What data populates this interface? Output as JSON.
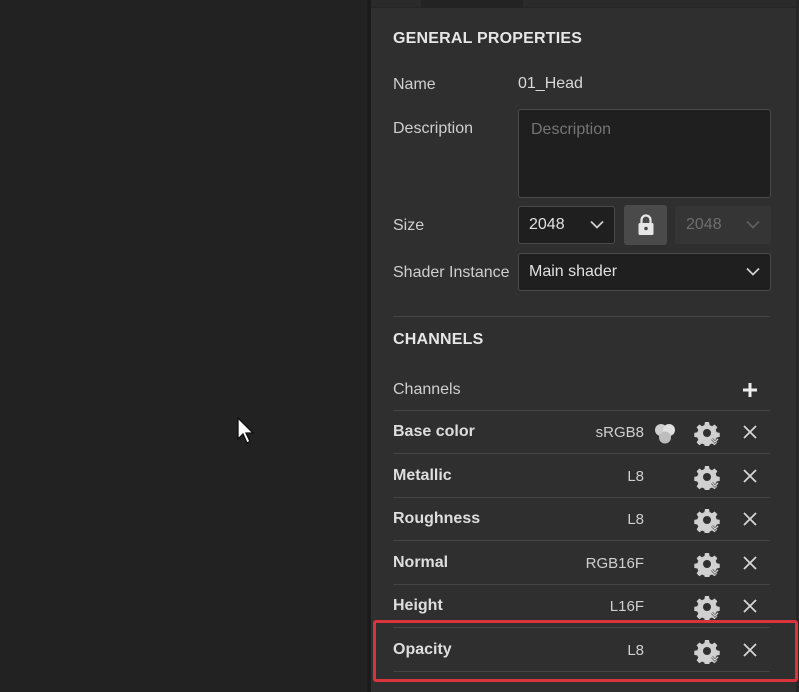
{
  "general": {
    "title": "GENERAL PROPERTIES",
    "name_label": "Name",
    "name_value": "01_Head",
    "description_label": "Description",
    "description_placeholder": "Description",
    "size_label": "Size",
    "size_value": "2048",
    "size_value_locked": "2048",
    "shader_label": "Shader Instance",
    "shader_value": "Main shader"
  },
  "channels": {
    "title": "CHANNELS",
    "list_label": "Channels",
    "items": [
      {
        "name": "Base color",
        "format": "sRGB8"
      },
      {
        "name": "Metallic",
        "format": "L8"
      },
      {
        "name": "Roughness",
        "format": "L8"
      },
      {
        "name": "Normal",
        "format": "RGB16F"
      },
      {
        "name": "Height",
        "format": "L16F"
      },
      {
        "name": "Opacity",
        "format": "L8"
      }
    ]
  },
  "colors": {
    "highlight": "#d9343d",
    "panel_bg": "#2f2f2f",
    "viewport_bg": "#222222"
  },
  "icons": {
    "cursor": "arrow-cursor-icon",
    "lock": "lock-icon",
    "add": "plus-icon",
    "mix": "color-mix-icon",
    "settings": "gear-icon",
    "remove": "close-icon",
    "dropdown": "chevron-down-icon"
  }
}
